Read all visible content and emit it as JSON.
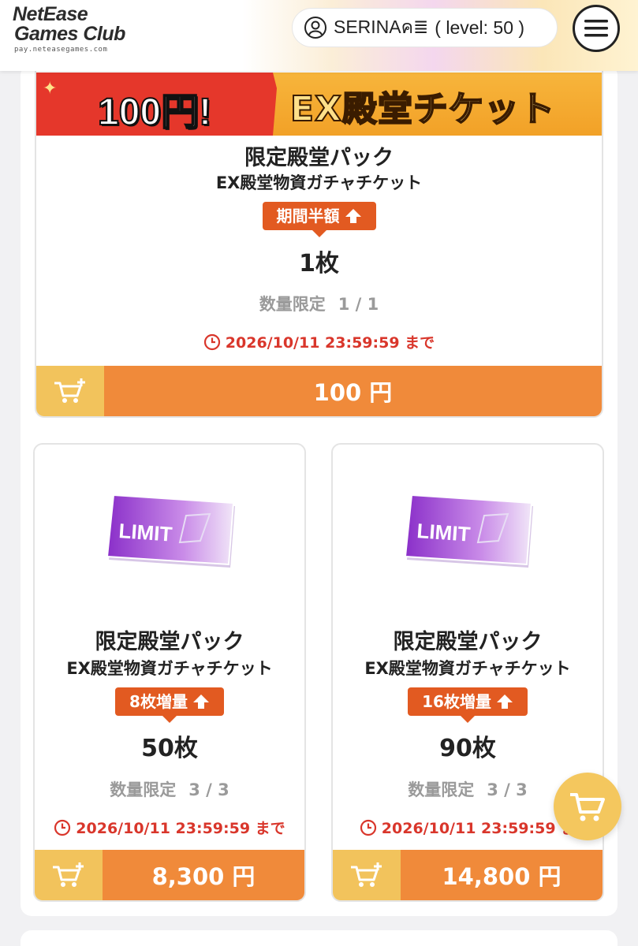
{
  "header": {
    "logo_line1": "NetEase",
    "logo_line2": "Games Club",
    "logo_url_text": "pay.neteasegames.com",
    "username": "SERINAค≣",
    "level": "( level: 50 )"
  },
  "featured": {
    "banner_left": "100円!",
    "banner_right": "EX殿堂チケット",
    "title": "限定殿堂パック",
    "subtitle": "EX殿堂物資ガチャチケット",
    "badge": "期間半額",
    "quantity": "1枚",
    "limit_label": "数量限定",
    "limit_value": "1 / 1",
    "deadline": "2026/10/11 23:59:59 まで",
    "price": "100 円"
  },
  "products": [
    {
      "ticket_label": "LIMIT",
      "title": "限定殿堂パック",
      "subtitle": "EX殿堂物資ガチャチケット",
      "badge": "8枚増量",
      "quantity": "50枚",
      "limit_label": "数量限定",
      "limit_value": "3 / 3",
      "deadline": "2026/10/11 23:59:59 まで",
      "price": "8,300 円"
    },
    {
      "ticket_label": "LIMIT",
      "title": "限定殿堂パック",
      "subtitle": "EX殿堂物資ガチャチケット",
      "badge": "16枚増量",
      "quantity": "90枚",
      "limit_label": "数量限定",
      "limit_value": "3 / 3",
      "deadline": "2026/10/11 23:59:59 ま",
      "price": "14,800 円"
    }
  ],
  "colors": {
    "badge": "#e25a21",
    "price_bar": "#f08a3a",
    "cart_box": "#f2c35c",
    "deadline": "#d9362b",
    "banner_red": "#e5372b"
  },
  "icons": {
    "user": "user-circle-icon",
    "menu": "hamburger-menu-icon",
    "cart": "cart-plus-icon",
    "clock": "clock-icon",
    "badge_arrow": "up-arrow-icon",
    "floating_cart": "cart-icon"
  }
}
